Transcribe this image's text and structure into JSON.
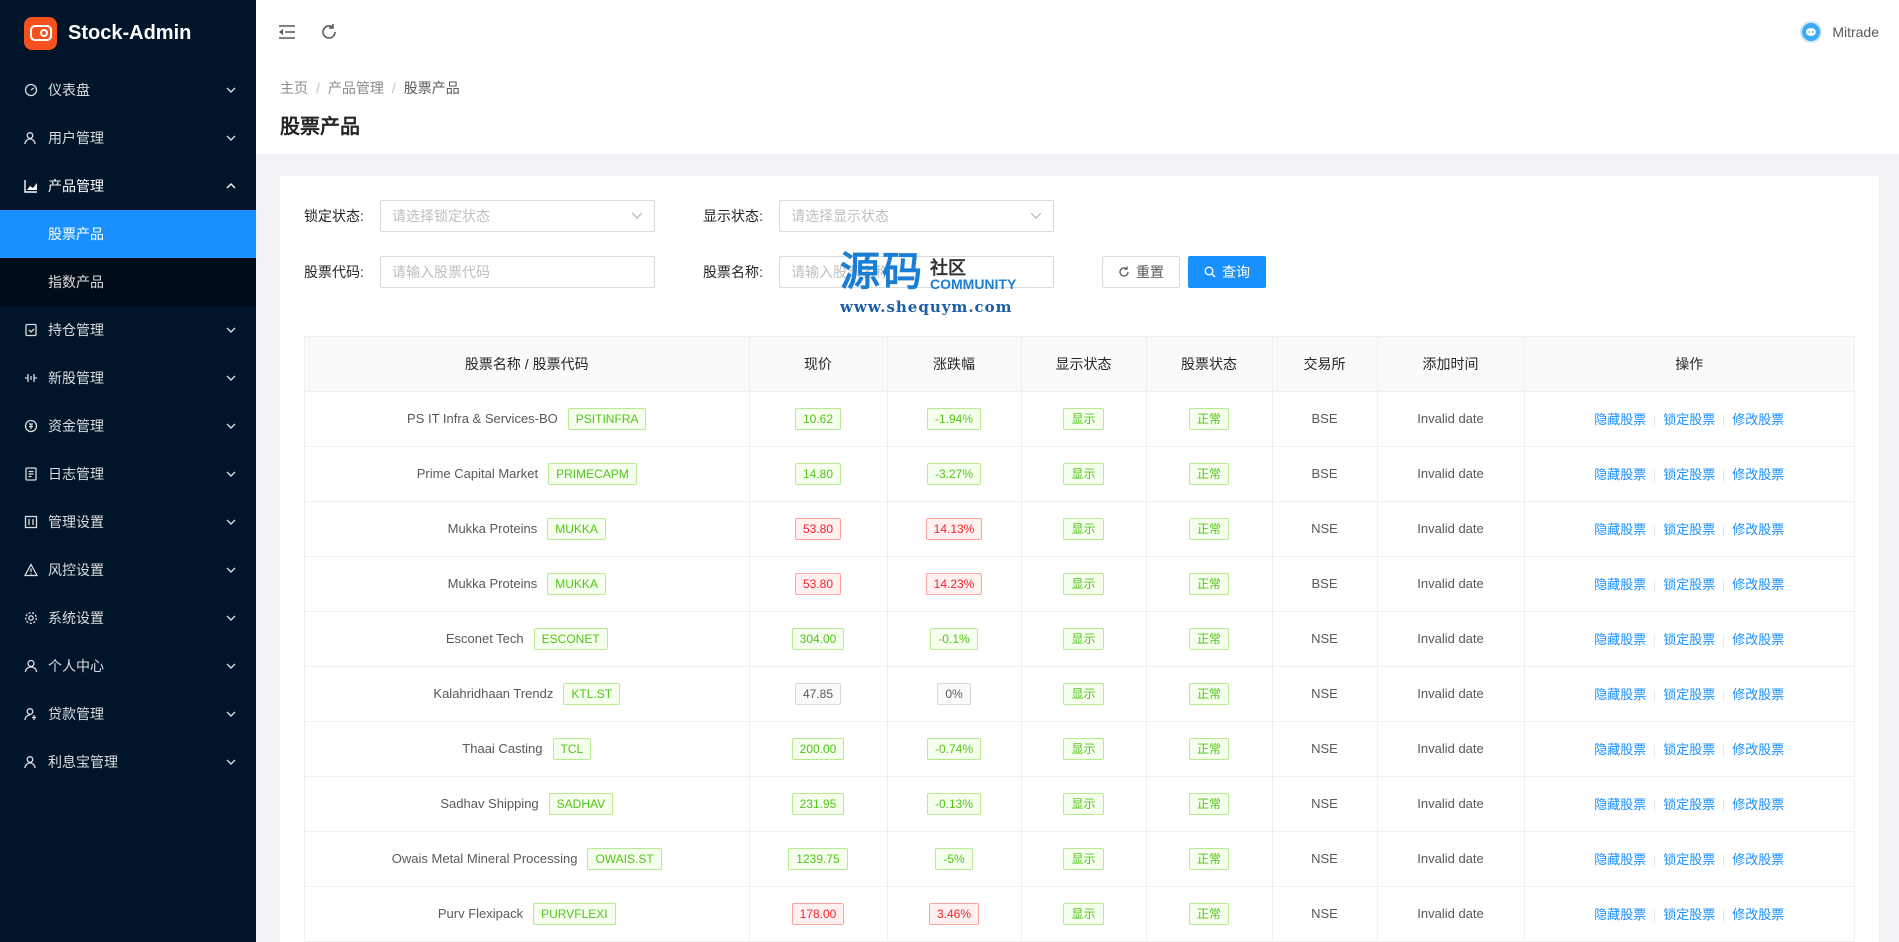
{
  "app": {
    "title": "Stock-Admin"
  },
  "sidebar": {
    "items": [
      {
        "label": "仪表盘",
        "icon": "dashboard-icon",
        "name": "sidebar-item-dashboard"
      },
      {
        "label": "用户管理",
        "icon": "user-manage-icon",
        "name": "sidebar-item-users"
      },
      {
        "label": "产品管理",
        "icon": "area-chart-icon",
        "name": "sidebar-item-products",
        "open": true,
        "children": [
          {
            "label": "股票产品",
            "name": "sidebar-subitem-stock-products",
            "active": true
          },
          {
            "label": "指数产品",
            "name": "sidebar-subitem-index-products"
          }
        ]
      },
      {
        "label": "持仓管理",
        "icon": "position-icon",
        "name": "sidebar-item-positions"
      },
      {
        "label": "新股管理",
        "icon": "new-stock-icon",
        "name": "sidebar-item-ipo"
      },
      {
        "label": "资金管理",
        "icon": "money-icon",
        "name": "sidebar-item-funds"
      },
      {
        "label": "日志管理",
        "icon": "log-icon",
        "name": "sidebar-item-logs"
      },
      {
        "label": "管理设置",
        "icon": "settings-panel-icon",
        "name": "sidebar-item-admin-settings"
      },
      {
        "label": "风控设置",
        "icon": "warning-icon",
        "name": "sidebar-item-risk"
      },
      {
        "label": "系统设置",
        "icon": "gear-icon",
        "name": "sidebar-item-system"
      },
      {
        "label": "个人中心",
        "icon": "person-icon",
        "name": "sidebar-item-profile"
      },
      {
        "label": "贷款管理",
        "icon": "loan-icon",
        "name": "sidebar-item-loans"
      },
      {
        "label": "利息宝管理",
        "icon": "interest-icon",
        "name": "sidebar-item-interest"
      }
    ]
  },
  "header": {
    "username": "Mitrade"
  },
  "breadcrumb": [
    "主页",
    "产品管理",
    "股票产品"
  ],
  "page": {
    "title": "股票产品"
  },
  "filters": {
    "lock_label": "锁定状态:",
    "lock_placeholder": "请选择锁定状态",
    "display_label": "显示状态:",
    "display_placeholder": "请选择显示状态",
    "code_label": "股票代码:",
    "code_placeholder": "请输入股票代码",
    "name_label": "股票名称:",
    "name_placeholder": "请输入股票名称",
    "reset_label": "重置",
    "search_label": "查询"
  },
  "watermark": {
    "big": "源码",
    "cn": "社区",
    "en": "COMMUNITY",
    "url": "www.shequym.com"
  },
  "table": {
    "columns": [
      "股票名称 / 股票代码",
      "现价",
      "涨跌幅",
      "显示状态",
      "股票状态",
      "交易所",
      "添加时间",
      "操作"
    ],
    "actions": [
      "隐藏股票",
      "锁定股票",
      "修改股票"
    ],
    "rows": [
      {
        "name": "PS IT Infra & Services-BO",
        "code": "PSITINFRA",
        "price": "10.62",
        "change": "-1.94%",
        "trend": "green",
        "display": "显示",
        "status": "正常",
        "exchange": "BSE",
        "added": "Invalid date"
      },
      {
        "name": "Prime Capital Market",
        "code": "PRIMECAPM",
        "price": "14.80",
        "change": "-3.27%",
        "trend": "green",
        "display": "显示",
        "status": "正常",
        "exchange": "BSE",
        "added": "Invalid date"
      },
      {
        "name": "Mukka Proteins",
        "code": "MUKKA",
        "price": "53.80",
        "change": "14.13%",
        "trend": "red",
        "display": "显示",
        "status": "正常",
        "exchange": "NSE",
        "added": "Invalid date"
      },
      {
        "name": "Mukka Proteins",
        "code": "MUKKA",
        "price": "53.80",
        "change": "14.23%",
        "trend": "red",
        "display": "显示",
        "status": "正常",
        "exchange": "BSE",
        "added": "Invalid date"
      },
      {
        "name": "Esconet Tech",
        "code": "ESCONET",
        "price": "304.00",
        "change": "-0.1%",
        "trend": "green",
        "display": "显示",
        "status": "正常",
        "exchange": "NSE",
        "added": "Invalid date"
      },
      {
        "name": "Kalahridhaan Trendz",
        "code": "KTL.ST",
        "price": "47.85",
        "change": "0%",
        "trend": "gray",
        "display": "显示",
        "status": "正常",
        "exchange": "NSE",
        "added": "Invalid date"
      },
      {
        "name": "Thaai Casting",
        "code": "TCL",
        "price": "200.00",
        "change": "-0.74%",
        "trend": "green",
        "display": "显示",
        "status": "正常",
        "exchange": "NSE",
        "added": "Invalid date"
      },
      {
        "name": "Sadhav Shipping",
        "code": "SADHAV",
        "price": "231.95",
        "change": "-0.13%",
        "trend": "green",
        "display": "显示",
        "status": "正常",
        "exchange": "NSE",
        "added": "Invalid date"
      },
      {
        "name": "Owais Metal Mineral Processing",
        "code": "OWAIS.ST",
        "price": "1239.75",
        "change": "-5%",
        "trend": "green",
        "display": "显示",
        "status": "正常",
        "exchange": "NSE",
        "added": "Invalid date"
      },
      {
        "name": "Purv Flexipack",
        "code": "PURVFLEXI",
        "price": "178.00",
        "change": "3.46%",
        "trend": "red",
        "display": "显示",
        "status": "正常",
        "exchange": "NSE",
        "added": "Invalid date"
      }
    ]
  }
}
